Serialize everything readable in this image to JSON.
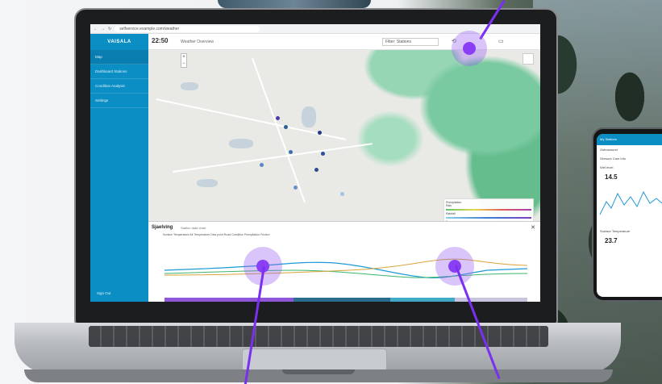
{
  "browser": {
    "url": "selfservice.example.com/weather"
  },
  "header": {
    "logo": "VAISALA",
    "clock": "22:50",
    "clock_sub": "Weather Overview",
    "filter_placeholder": "Filter: Stations"
  },
  "sidebar": {
    "items": [
      {
        "label": "Map",
        "active": true
      },
      {
        "label": "Dashboard Stations",
        "active": false
      },
      {
        "label": "Condition Analysis",
        "active": false
      },
      {
        "label": "Settings",
        "active": false
      }
    ],
    "footer": "Sign Out"
  },
  "legend": {
    "title": "Precipitation",
    "rows": [
      "Rain",
      "Rainfall",
      "Snow"
    ],
    "scale_title": "Surface Status"
  },
  "chart": {
    "title": "Sjaelving",
    "subtitle": "Station data chart",
    "legend": "Surface Temperature   Air Temperature   Dew point   Road Condition   Precipitation   Friction"
  },
  "phone": {
    "header": "My Stations",
    "station": "Ostmarsund",
    "tabs": "Sensors  Cam  Info",
    "metric1_label": "Wet level",
    "metric1_value": "14.5",
    "metric2_label": "Surface Temperature",
    "metric2_value": "23.7"
  },
  "colors": {
    "brand": "#0b8ec4",
    "marker": "#7b2ff0",
    "map_radar": "#57b884"
  },
  "icons": [
    "back-icon",
    "forward-icon",
    "reload-icon",
    "calendar-icon",
    "layers-icon",
    "close-icon"
  ]
}
